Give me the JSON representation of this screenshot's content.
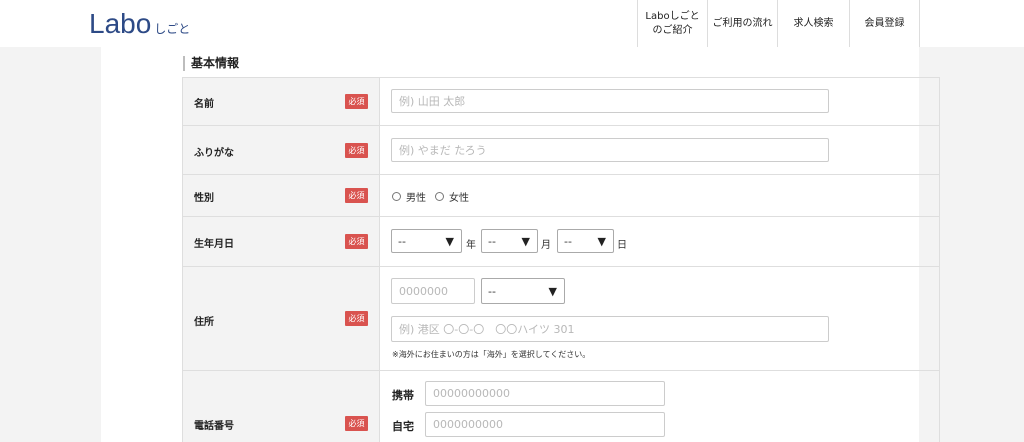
{
  "header": {
    "logo_main": "Labo",
    "logo_sub": "しごと",
    "nav": [
      {
        "line1": "Laboしごと",
        "line2": "のご紹介"
      },
      {
        "line1": "ご利用の流れ",
        "line2": ""
      },
      {
        "line1": "求人検索",
        "line2": ""
      },
      {
        "line1": "会員登録",
        "line2": ""
      }
    ]
  },
  "section_title": "基本情報",
  "required_label": "必須",
  "form": {
    "name": {
      "label": "名前",
      "placeholder": "例) 山田 太郎"
    },
    "furigana": {
      "label": "ふりがな",
      "placeholder": "例) やまだ たろう"
    },
    "gender": {
      "label": "性別",
      "options": [
        "男性",
        "女性"
      ]
    },
    "birthday": {
      "label": "生年月日",
      "year_value": "--",
      "year_unit": "年",
      "month_value": "--",
      "month_unit": "月",
      "day_value": "--",
      "day_unit": "日",
      "arrow": "▼"
    },
    "address": {
      "label": "住所",
      "zip_placeholder": "0000000",
      "pref_value": "--",
      "arrow": "▼",
      "street_placeholder": "例) 港区 〇-〇-〇　〇〇ハイツ 301",
      "note": "※海外にお住まいの方は「海外」を選択してください。"
    },
    "phone": {
      "label": "電話番号",
      "mobile_label": "携帯",
      "mobile_placeholder": "00000000000",
      "home_label": "自宅",
      "home_placeholder": "0000000000"
    }
  }
}
